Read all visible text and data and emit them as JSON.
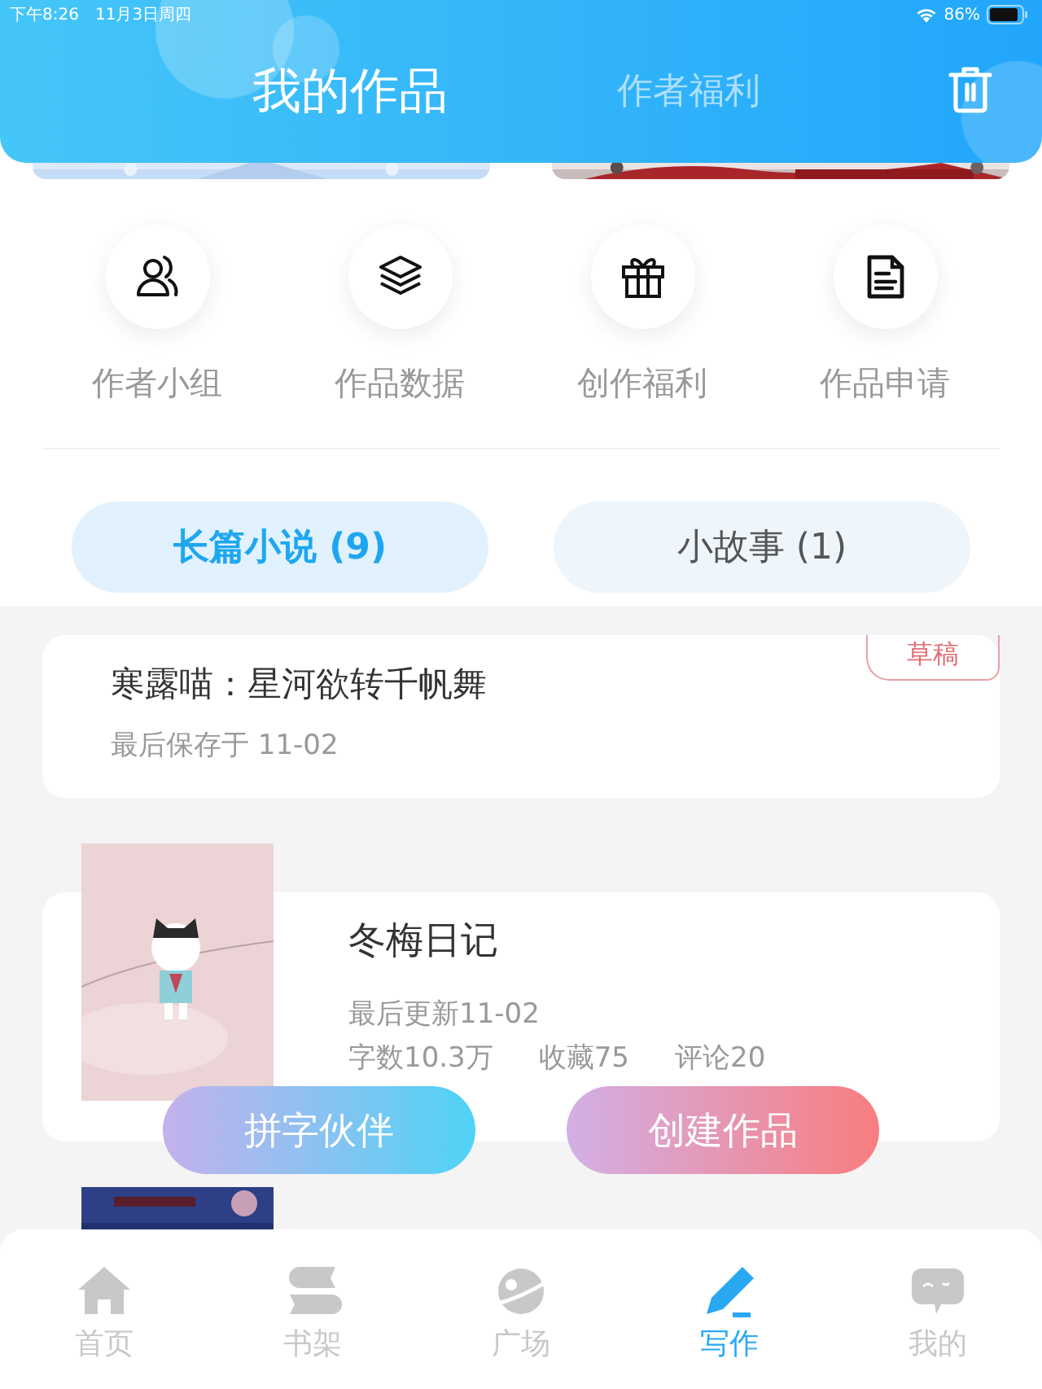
{
  "status_bar": {
    "time": "下午8:26",
    "date": "11月3日周四",
    "battery": "86%"
  },
  "header_tabs": [
    {
      "label": "我的作品",
      "selected": true
    },
    {
      "label": "作者福利",
      "selected": false
    }
  ],
  "quick_actions": [
    {
      "label": "作者小组"
    },
    {
      "label": "作品数据"
    },
    {
      "label": "创作福利"
    },
    {
      "label": "作品申请"
    }
  ],
  "segments": [
    {
      "label": "长篇小说 (9)",
      "selected": true
    },
    {
      "label": "小故事 (1)",
      "selected": false
    }
  ],
  "works": [
    {
      "kind": "draft",
      "title": "寒露喵：星河欲转千帆舞",
      "note": "最后保存于 11-02",
      "tag": "草稿"
    },
    {
      "kind": "published",
      "title": "冬梅日记",
      "note": "最后更新11-02",
      "stats": [
        "字数10.3万",
        "收藏75",
        "评论20"
      ]
    },
    {
      "kind": "cover_only"
    }
  ],
  "actions": [
    "拼字伙伴",
    "创建作品"
  ],
  "nav": [
    {
      "label": "首页",
      "selected": false
    },
    {
      "label": "书架",
      "selected": false
    },
    {
      "label": "广场",
      "selected": false
    },
    {
      "label": "写作",
      "selected": true
    },
    {
      "label": "我的",
      "selected": false
    }
  ]
}
